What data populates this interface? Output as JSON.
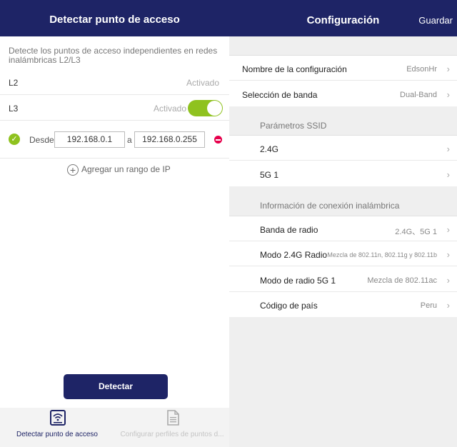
{
  "left": {
    "title": "Detectar punto de acceso",
    "description": "Detecte los puntos de acceso independientes en redes inalámbricas L2/L3",
    "l2": {
      "label": "L2",
      "status": "Activado"
    },
    "l3": {
      "label": "L3",
      "status": "Activado",
      "enabled": true
    },
    "range": {
      "from_label": "Desde",
      "from_value": "192.168.0.1",
      "sep": "a",
      "to_value": "192.168.0.255"
    },
    "add_range_label": "Agregar un rango de IP",
    "detect_button": "Detectar",
    "nav": [
      {
        "label": "Detectar punto de acceso",
        "active": true
      },
      {
        "label": "Configurar perfiles de puntos d...",
        "active": false
      }
    ]
  },
  "right": {
    "title": "Configuración",
    "save_label": "Guardar",
    "general": [
      {
        "label": "Nombre de la configuración",
        "value": "EdsonHr"
      },
      {
        "label": "Selección de banda",
        "value": "Dual-Band"
      }
    ],
    "ssid_header": "Parámetros SSID",
    "ssid": [
      {
        "label": "2.4G",
        "value": ""
      },
      {
        "label": "5G 1",
        "value": ""
      }
    ],
    "wireless_header": "Información de conexión inalámbrica",
    "wireless": [
      {
        "label": "Banda de radio",
        "value": "2.4G、5G 1"
      },
      {
        "label": "Modo 2.4G Radio",
        "value": "Mezcla de 802.11n, 802.11g y 802.11b"
      },
      {
        "label": "Modo de radio 5G 1",
        "value": "Mezcla de 802.11ac"
      },
      {
        "label": "Código de país",
        "value": "Peru"
      }
    ]
  },
  "colors": {
    "header": "#1e2466",
    "accent_green": "#8fc21f",
    "remove_red": "#e6004c",
    "page_bg": "#efefef"
  }
}
